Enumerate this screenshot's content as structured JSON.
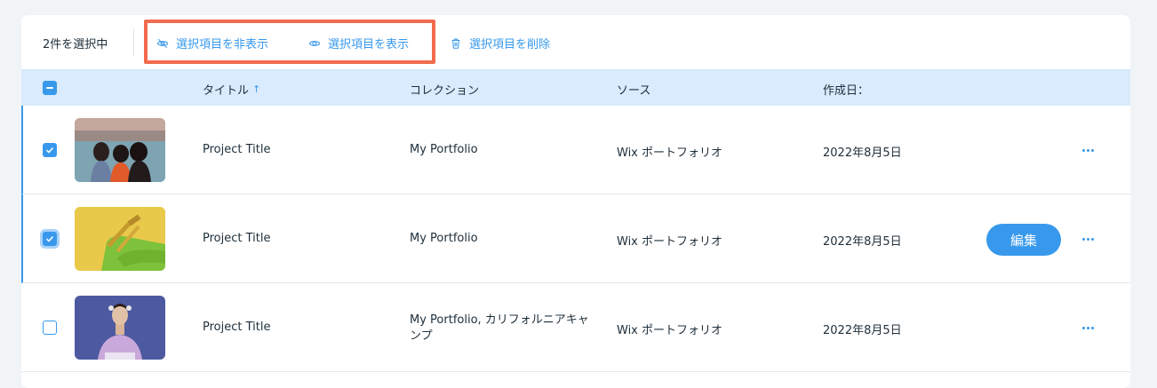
{
  "toolbar": {
    "selected_count": "2件を選択中",
    "hide_label": "選択項目を非表示",
    "show_label": "選択項目を表示",
    "delete_label": "選択項目を削除",
    "highlight_color": "#f26b4d",
    "accent_color": "#3899ec"
  },
  "table": {
    "columns": [
      "タイトル",
      "コレクション",
      "ソース",
      "作成日："
    ],
    "sort_column": "タイトル",
    "sort_direction": "ascending",
    "header_bg": "#d9ebfc",
    "rows": [
      {
        "selected": true,
        "thumbnail": "three people from behind facing the sea",
        "title": "Project Title",
        "collection": "My Portfolio",
        "source": "Wix ポートフォリオ",
        "created": "2022年8月5日",
        "show_edit": false
      },
      {
        "selected": true,
        "thumbnail": "green-stockinged legs with yellow sandals on yellow background",
        "title": "Project Title",
        "collection": "My Portfolio",
        "source": "Wix ポートフォリオ",
        "created": "2022年8月5日",
        "show_edit": true,
        "edit_label": "編集"
      },
      {
        "selected": false,
        "thumbnail": "person in lavender top against purple background",
        "title": "Project Title",
        "collection": "My Portfolio, カリフォルニアキャンプ",
        "source": "Wix ポートフォリオ",
        "created": "2022年8月5日",
        "show_edit": false
      }
    ]
  },
  "icons": {
    "hide": "eye-slash-icon",
    "show": "eye-icon",
    "delete": "trash-icon",
    "sort": "arrow-up-icon",
    "more": "more-dots-icon",
    "check": "check-icon"
  }
}
